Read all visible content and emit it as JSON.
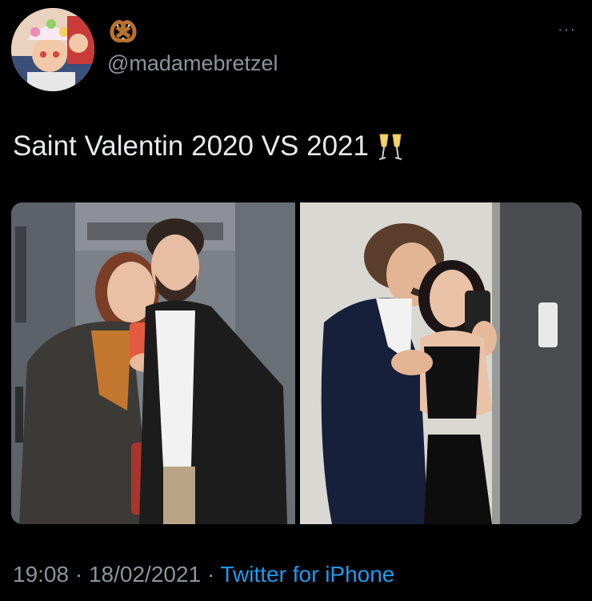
{
  "author": {
    "display_name_icon": "pretzel-icon",
    "handle": "@madamebretzel",
    "avatar_icon": "avatar"
  },
  "more_label": "···",
  "tweet": {
    "text": "Saint Valentin 2020 VS 2021",
    "emoji_icon": "champagne-glasses-icon"
  },
  "media": [
    {
      "name": "photo-2020",
      "description_icon": "elevator-selfie-photo"
    },
    {
      "name": "photo-2021",
      "description_icon": "couple-selfie-photo"
    }
  ],
  "meta": {
    "time": "19:08",
    "separator": " · ",
    "date": "18/02/2021",
    "source": "Twitter for iPhone"
  },
  "colors": {
    "background": "#000000",
    "text": "#e7e9ea",
    "muted": "#8b949b",
    "link": "#1d9bf0"
  }
}
